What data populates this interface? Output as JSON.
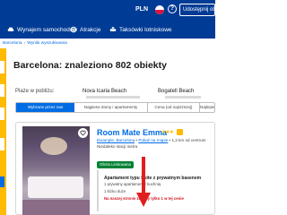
{
  "header": {
    "currency": "PLN",
    "help_icon_label": "?",
    "list_property_label": "Udostępnij obiekt",
    "nav": [
      {
        "label": "Wynajem samochodów",
        "icon": "car-icon"
      },
      {
        "label": "Atrakcje",
        "icon": "attractions-icon"
      },
      {
        "label": "Taksówki lotniskowe",
        "icon": "taxi-icon"
      }
    ]
  },
  "breadcrumb": [
    "Barcelona",
    "Wyniki wyszukiwania"
  ],
  "main": {
    "title": "Barcelona: znaleziono 802 obiekty",
    "nearby_label": "Plaże w pobliżu:",
    "nearby": [
      "Nova Icaria Beach",
      "Bogatell Beach"
    ],
    "sort_tabs": [
      "Wybrane przez nas",
      "Najpierw domy i apartamenty",
      "Cena (od najniższej)",
      "Najlepiej oceniane"
    ]
  },
  "listing": {
    "name": "Room Mate Emma",
    "stars": "★★★",
    "location_link": "Eixample, Barcelona",
    "map_link": "Pokaż na mapie",
    "distance": "1,3 km od centrum",
    "metro": "Niedaleko stacji metra",
    "badge": "Oferta Limitowana",
    "room_type": "Apartament typu Suite z prywatnym basenem",
    "bed_1": "1 prywatny apartament z kuchnią",
    "bed_2": "1 łóżko duże",
    "urgency": "Na naszej stronie zostały tylko 1 w tej cenie"
  },
  "colors": {
    "header_bg": "#003b95",
    "accent": "#006ce4",
    "sidebar": "#febb02",
    "badge": "#008234",
    "urgent": "#d4111e",
    "annotation_arrow": "#e01e1e"
  }
}
